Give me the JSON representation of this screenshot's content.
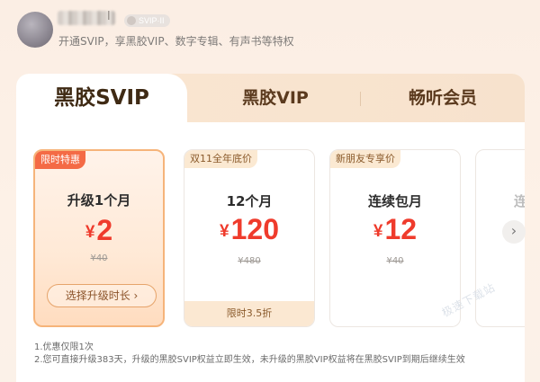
{
  "header": {
    "username_suffix": "l",
    "badge": "SVIP·II",
    "subtitle": "开通SVIP，享黑胶VIP、数字专辑、有声书等特权"
  },
  "tabs": [
    {
      "label": "黑胶SVIP",
      "active": true
    },
    {
      "label": "黑胶VIP",
      "active": false
    },
    {
      "label": "畅听会员",
      "active": false
    }
  ],
  "cards": [
    {
      "tag": "限时特惠",
      "title": "升级1个月",
      "currency": "¥",
      "price": "2",
      "original": "¥40",
      "button": "选择升级时长 ›",
      "selected": true
    },
    {
      "tag": "双11全年底价",
      "title": "12个月",
      "currency": "¥",
      "price": "120",
      "original": "¥480",
      "footer": "限时3.5折"
    },
    {
      "tag": "新朋友专享价",
      "title": "连续包月",
      "currency": "¥",
      "price": "12",
      "original": "¥40"
    },
    {
      "title": "连"
    }
  ],
  "next_icon": "chevron-right-icon",
  "notes": [
    "1.优惠仅限1次",
    "2.您可直接升级383天，升级的黑胶SVIP权益立即生效，未升级的黑胶VIP权益将在黑胶SVIP到期后继续生效"
  ],
  "watermark": "极速下载站",
  "colors": {
    "accent": "#ef3b2c",
    "tag_selected": "#f46a45",
    "brown": "#5b3a1e"
  }
}
